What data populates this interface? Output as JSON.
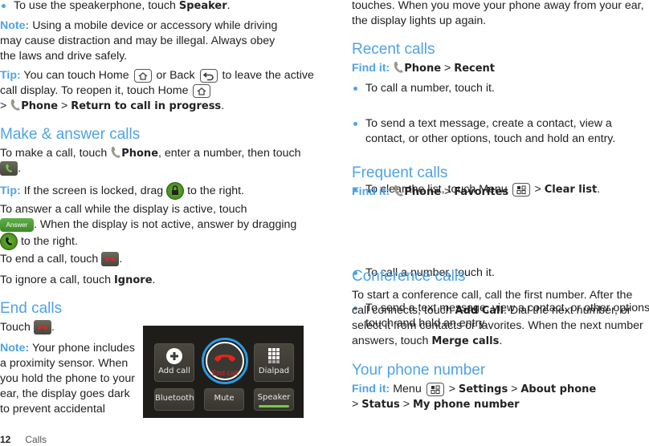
{
  "left": {
    "speaker_bullet": {
      "pre": "To use the speakerphone, touch ",
      "bold": "Speaker",
      "post": "."
    },
    "note1": {
      "label": "Note:",
      "text": " Using a mobile device or accessory while driving may cause distraction and may be illegal. Always obey the laws and drive safely."
    },
    "tip1": {
      "label": "Tip:",
      "t1": " You can touch Home ",
      "t2": " or Back ",
      "t3": " to leave the active call display. To reopen it, touch Home ",
      "t4": " > ",
      "b1": "Phone",
      "t5": " > ",
      "b2": "Return to call in progress",
      "t6": "."
    },
    "make_answer": {
      "heading": "Make & answer calls",
      "p1": {
        "t1": "To make a call, touch ",
        "b1": "Phone",
        "t2": ", enter a number, then touch ",
        "t3": "."
      },
      "tip": {
        "label": "Tip:",
        "t1": " If the screen is locked, drag ",
        "t2": " to the right."
      },
      "p2": {
        "t1": "To answer a call while the display is active, touch ",
        "answer_label": "Answer",
        "t2": ". When the display is not active, answer by dragging ",
        "t3": " to the right."
      },
      "p3": {
        "t1": "To end a call, touch ",
        "t2": "."
      },
      "p4": {
        "t1": "To ignore a call, touch ",
        "b1": "Ignore",
        "t2": "."
      }
    },
    "end_calls": {
      "heading": "End calls",
      "p1": {
        "t1": "Touch ",
        "t2": "."
      },
      "note": {
        "label": "Note:",
        "text": " Your phone includes a proximity sensor. When you hold the phone to your ear, the display goes dark to prevent accidental"
      }
    },
    "phone_screen": {
      "buttons": [
        "Add call",
        "End call",
        "Dialpad",
        "Bluetooth",
        "Mute",
        "Speaker"
      ],
      "colors": {
        "end_call": "#e8231f",
        "ring": "#2a9be8",
        "speaker_active": "#7ac943"
      }
    }
  },
  "right": {
    "continuation": "touches. When you move your phone away from your ear, the display lights up again.",
    "recent": {
      "heading": "Recent calls",
      "findit": {
        "label": "Find it:",
        "b1": "Phone",
        "sep": " > ",
        "b2": "Recent"
      },
      "bullets": [
        "To call a number, touch it.",
        "To send a text message, create a contact, view a contact, or other options, touch and hold an entry."
      ],
      "clear": {
        "t1": "To clear the list, touch Menu ",
        "t2": " > ",
        "b1": "Clear list",
        "t3": "."
      }
    },
    "frequent": {
      "heading": "Frequent calls",
      "findit": {
        "label": "Find it:",
        "b1": "Phone",
        "sep": " > ",
        "b2": "Favorites"
      },
      "bullets": [
        "To call a number, touch it.",
        "To send a text message, view a contact, or other options, touch and hold an entry."
      ]
    },
    "conference": {
      "heading": "Conference calls",
      "p": {
        "t1": "To start a conference call, call the first number. After the call connects, touch ",
        "b1": "Add Call",
        "t2": ". Dial the next number, or select it from contacts or favorites. When the next number answers, touch ",
        "b2": "Merge calls",
        "t3": "."
      }
    },
    "your_number": {
      "heading": "Your phone number",
      "findit": {
        "label": "Find it:",
        "t1": " Menu ",
        "sep": " > ",
        "b1": "Settings",
        "b2": "About phone",
        "b3": "Status",
        "b4": "My phone number"
      }
    }
  },
  "footer": {
    "page": "12",
    "section": "Calls"
  },
  "colors": {
    "accent": "#4ea3e6"
  }
}
